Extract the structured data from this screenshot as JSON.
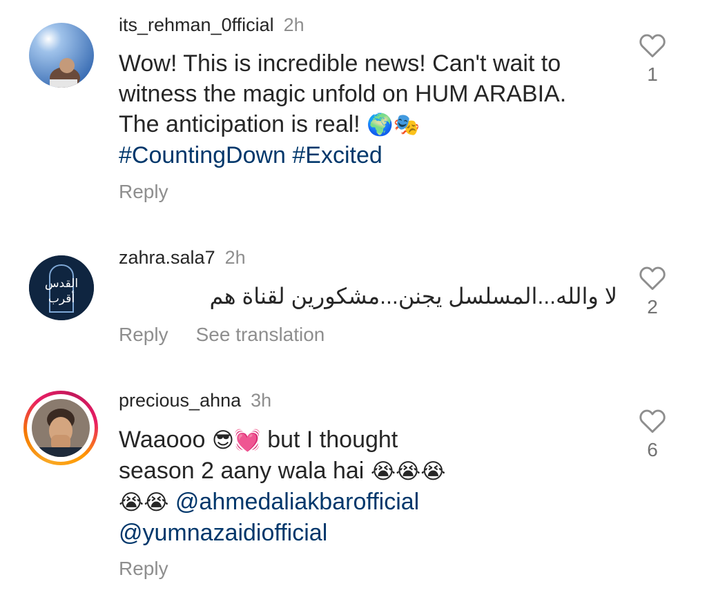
{
  "comments": [
    {
      "username": "its_rehman_0fficial",
      "time": "2h",
      "text": "Wow! This is incredible news! Can't wait to witness the magic unfold on HUM ARABIA. The anticipation is real!",
      "emojis": "🌍🎭",
      "hashtags": "#CountingDown #Excited",
      "reply": "Reply",
      "likes": "1"
    },
    {
      "username": "zahra.sala7",
      "time": "2h",
      "text": "لا والله...المسلسل يجنن...مشكورين لقناة هم",
      "reply": "Reply",
      "translate": "See translation",
      "likes": "2",
      "avatar_text_top": "القدس",
      "avatar_text_bottom": "أقرب"
    },
    {
      "username": "precious_ahna",
      "time": "3h",
      "text_a": "Waaooo",
      "emojis_a": "😎💓",
      "text_b": "but I thought",
      "text_c": "season 2 aany wala hai",
      "emojis_c": "😭😭😭",
      "emojis_d": "😭😭",
      "mention_1": "@ahmedaliakbarofficial",
      "mention_2": "@yumnazaidiofficial",
      "reply": "Reply",
      "likes": "6"
    }
  ]
}
